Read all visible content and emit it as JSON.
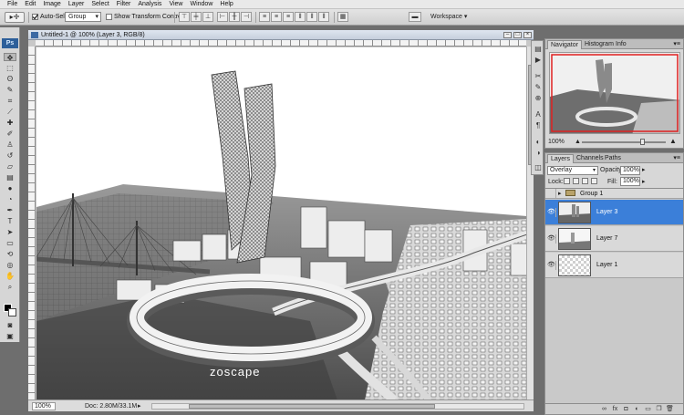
{
  "menubar": {
    "items": [
      "File",
      "Edit",
      "Image",
      "Layer",
      "Select",
      "Filter",
      "Analysis",
      "View",
      "Window",
      "Help"
    ]
  },
  "options_bar": {
    "tool_icon": "move-tool-icon",
    "auto_select_label": "Auto-Select:",
    "auto_select_checked": true,
    "auto_select_value": "Group",
    "show_transform_label": "Show Transform Controls",
    "show_transform_checked": false,
    "workspace_label": "Workspace ▾"
  },
  "tools": {
    "logo": "Ps",
    "icons": [
      "move-tool-icon",
      "marquee-tool-icon",
      "lasso-tool-icon",
      "quick-select-icon",
      "crop-tool-icon",
      "eyedropper-icon",
      "healing-brush-icon",
      "brush-tool-icon",
      "clone-stamp-icon",
      "history-brush-icon",
      "eraser-icon",
      "gradient-tool-icon",
      "blur-tool-icon",
      "dodge-tool-icon",
      "pen-tool-icon",
      "type-tool-icon",
      "path-select-icon",
      "shape-tool-icon",
      "3d-rotate-icon",
      "3d-orbit-icon",
      "hand-tool-icon",
      "zoom-tool-icon"
    ]
  },
  "document": {
    "title": "Untitled-1 @ 100% (Layer 3, RGB/8)",
    "zoom": "100%",
    "doc_info": "Doc: 2.80M/33.1M",
    "watermark": "zoscape"
  },
  "navigator": {
    "tabs": [
      "Navigator",
      "Histogram",
      "Info"
    ],
    "zoom": "100%"
  },
  "layers_panel": {
    "tabs": [
      "Layers",
      "Channels",
      "Paths"
    ],
    "blend_mode": "Overlay",
    "opacity_label": "Opacity:",
    "opacity": "100%",
    "lock_label": "Lock:",
    "fill_label": "Fill:",
    "fill": "100%",
    "layers": [
      {
        "name": "Group 1",
        "type": "group",
        "selected": false
      },
      {
        "name": "Layer 3",
        "type": "image",
        "selected": true
      },
      {
        "name": "Layer 7",
        "type": "image",
        "selected": false
      },
      {
        "name": "Layer 1",
        "type": "empty",
        "selected": false
      }
    ],
    "footer_icons": [
      "link-icon",
      "fx-icon",
      "mask-icon",
      "adjustment-icon",
      "folder-icon",
      "new-layer-icon",
      "trash-icon"
    ]
  },
  "colors": {
    "selection_blue": "#3b7fd9",
    "navigator_box": "#e02020"
  }
}
